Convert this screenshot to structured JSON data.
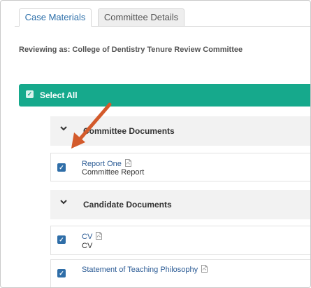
{
  "tabs": [
    {
      "label": "Case Materials",
      "active": true
    },
    {
      "label": "Committee Details",
      "active": false
    }
  ],
  "reviewing_text": "Reviewing as: College of Dentistry Tenure Review Committee",
  "select_all": {
    "label": "Select All",
    "checked": true
  },
  "sections": [
    {
      "title": "Committee Documents",
      "documents": [
        {
          "title": "Report One",
          "subtitle": "Committee Report",
          "checked": true,
          "icon": "pdf-icon"
        }
      ]
    },
    {
      "title": "Candidate Documents",
      "documents": [
        {
          "title": "CV",
          "subtitle": "CV",
          "checked": true,
          "icon": "pdf-icon"
        },
        {
          "title": "Statement of Teaching Philosophy",
          "subtitle": "",
          "checked": true,
          "icon": "pdf-icon"
        }
      ]
    }
  ],
  "colors": {
    "accent": "#16a98c",
    "link": "#2b5b95",
    "checkbox": "#2f6ea8",
    "arrow": "#d35a2b"
  }
}
